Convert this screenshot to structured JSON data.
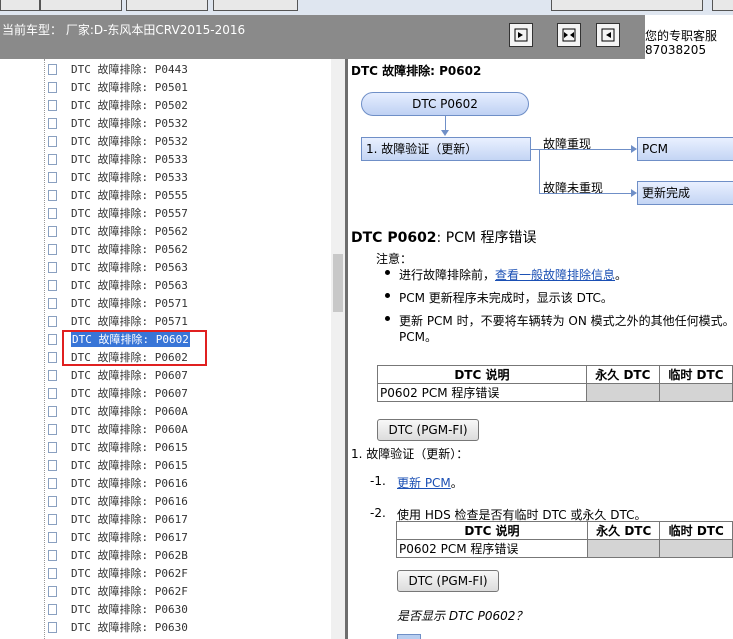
{
  "header": {
    "car_label": "当前车型： 厂家:D-东风本田CRV2015-2016",
    "service_line1": "您的专职客服",
    "service_line2": "87038205"
  },
  "nav_buttons": [
    {
      "icon": "dock-right-icon"
    },
    {
      "icon": "split-icon"
    },
    {
      "icon": "dock-left-icon"
    }
  ],
  "tree": {
    "items": [
      "DTC 故障排除: P0443",
      "DTC 故障排除: P0501",
      "DTC 故障排除: P0502",
      "DTC 故障排除: P0532",
      "DTC 故障排除: P0532",
      "DTC 故障排除: P0533",
      "DTC 故障排除: P0533",
      "DTC 故障排除: P0555",
      "DTC 故障排除: P0557",
      "DTC 故障排除: P0562",
      "DTC 故障排除: P0562",
      "DTC 故障排除: P0563",
      "DTC 故障排除: P0563",
      "DTC 故障排除: P0571",
      "DTC 故障排除: P0571",
      "DTC 故障排除: P0602",
      "DTC 故障排除: P0602",
      "DTC 故障排除: P0607",
      "DTC 故障排除: P0607",
      "DTC 故障排除: P060A",
      "DTC 故障排除: P060A",
      "DTC 故障排除: P0615",
      "DTC 故障排除: P0615",
      "DTC 故障排除: P0616",
      "DTC 故障排除: P0616",
      "DTC 故障排除: P0617",
      "DTC 故障排除: P0617",
      "DTC 故障排除: P062B",
      "DTC 故障排除: P062F",
      "DTC 故障排除: P062F",
      "DTC 故障排除: P0630",
      "DTC 故障排除: P0630"
    ],
    "selected_index": 15
  },
  "content": {
    "page_title": "DTC 故障排除: P0602",
    "flow": {
      "start": "DTC P0602",
      "step1": "1.  故障验证（更新）",
      "branch_yes": "故障重现",
      "branch_no": "故障未重现",
      "result_yes": "PCM",
      "result_no": "更新完成"
    },
    "dtc_heading_code": "DTC P0602",
    "dtc_heading_desc": ": PCM 程序错误",
    "note_label": "注意：",
    "notes": {
      "n1_pre": "进行故障排除前，",
      "n1_link": "查看一般故障排除信息",
      "n1_post": "。",
      "n2": "PCM 更新程序未完成时，显示该 DTC。",
      "n3_line1": "更新 PCM 时，不要将车辆转为 ON 模式之外的其他任何模式。",
      "n3_line2": "PCM。"
    },
    "table1": {
      "headers": [
        "DTC 说明",
        "永久 DTC",
        "临时 DTC"
      ],
      "row": [
        "P0602 PCM 程序错误",
        "",
        ""
      ]
    },
    "pgm_button": "DTC (PGM-FI)",
    "step1_label": "1.  故障验证（更新）：",
    "step1_1_num": "-1.",
    "step1_1_link": "更新 PCM",
    "step1_1_post": "。",
    "step1_2_num": "-2.",
    "step1_2_text": "使用 HDS 检查是否有临时 DTC 或永久 DTC。",
    "table2": {
      "headers": [
        "DTC 说明",
        "永久 DTC",
        "临时 DTC"
      ],
      "row": [
        "P0602 PCM 程序错误",
        "",
        ""
      ]
    },
    "pgm_button2": "DTC (PGM-FI)",
    "question": "是否显示 DTC P0602？"
  }
}
